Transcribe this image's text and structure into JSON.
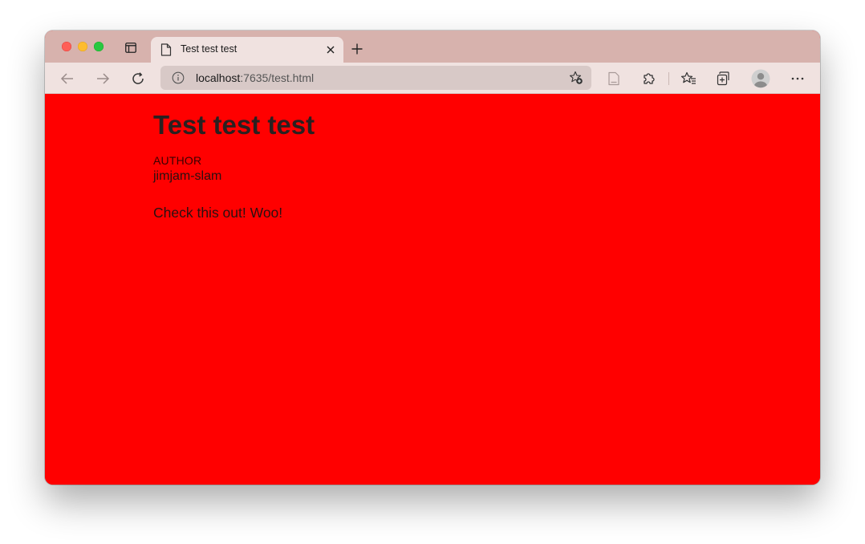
{
  "browser": {
    "tab": {
      "title": "Test test test"
    },
    "address_bar": {
      "host": "localhost",
      "rest": ":7635/test.html"
    },
    "icons": {
      "traffic_lights": [
        "close",
        "minimize",
        "maximize"
      ],
      "tab_actions": "tab-actions-icon",
      "favicon": "page-icon",
      "new_tab": "plus-icon",
      "back": "arrow-left-icon",
      "forward": "arrow-right-icon",
      "reload": "reload-icon",
      "site_info": "info-icon",
      "add_favorite": "star-add-icon",
      "reading_view": "reading-view-icon",
      "extensions": "puzzle-icon",
      "favorites": "favorites-icon",
      "collections": "collections-icon",
      "profile": "profile-avatar-icon",
      "more": "more-icon"
    },
    "colors": {
      "tabstrip": "#d7b2ad",
      "toolbar": "#f0e2e0",
      "page_background": "#ff0000"
    }
  },
  "page": {
    "title": "Test test test",
    "author_label": "AUTHOR",
    "author_name": "jimjam-slam",
    "content": "Check this out! Woo!"
  }
}
